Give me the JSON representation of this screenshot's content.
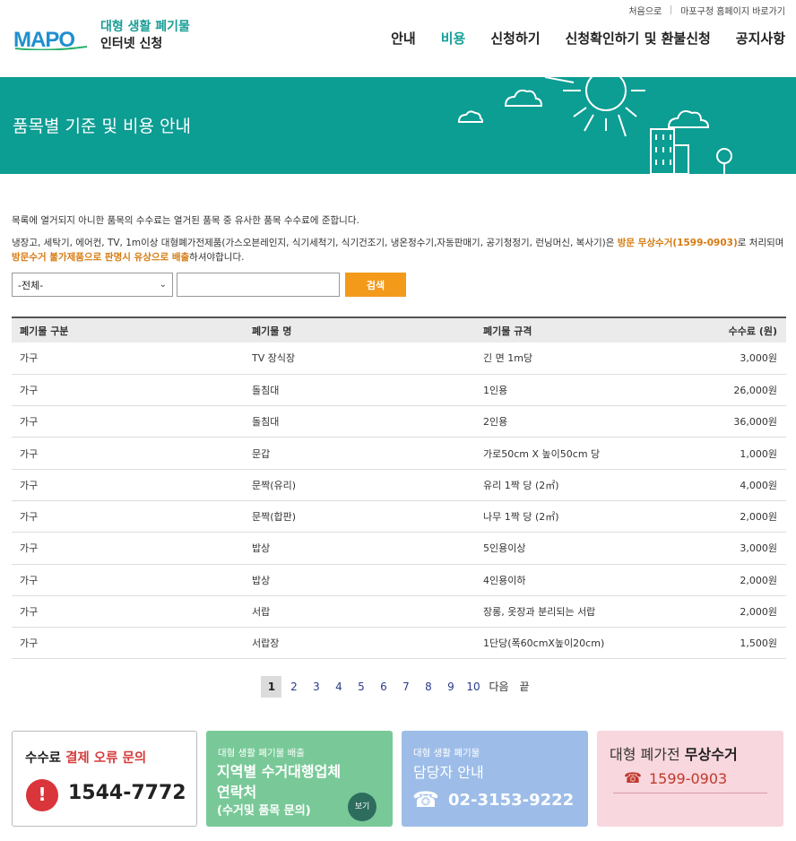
{
  "topbar": {
    "home": "처음으로",
    "mapo": "마포구청 홈페이지 바로가기"
  },
  "logo": {
    "mark": "MAPO",
    "line1": "대형 생활 폐기물",
    "line2": "인터넷 신청"
  },
  "gnb": [
    "안내",
    "비용",
    "신청하기",
    "신청확인하기 및 환불신청",
    "공지사항"
  ],
  "banner": {
    "title": "품목별 기준 및 비용 안내"
  },
  "notes": {
    "n1": "목록에 열거되지 아니한 품목의 수수료는 열거된 품목 중 유사한 품목 수수료에 준합니다.",
    "n2a": "냉장고, 세탁기, 에어컨, TV, 1m이상 대형폐가전제품(가스오븐레인지, 식기세척기, 식기건조기, 냉온정수기,자동판매기, 공기청정기, 런닝머신, 복사기)은 ",
    "n2b": "방문 무상수거(1599-0903)",
    "n2c": "로 처리되며 ",
    "n2d": "방문수거 불가제품으로 판명시 유상으로 배출",
    "n2e": "하셔야합니다."
  },
  "search": {
    "select_value": "-전체-",
    "input_value": "",
    "button": "검색"
  },
  "table": {
    "headers": [
      "폐기물 구분",
      "폐기물 명",
      "폐기물 규격",
      "수수료 (원)"
    ],
    "rows": [
      [
        "가구",
        "TV 장식장",
        "긴 면 1m당",
        "3,000원"
      ],
      [
        "가구",
        "돌침대",
        "1인용",
        "26,000원"
      ],
      [
        "가구",
        "돌침대",
        "2인용",
        "36,000원"
      ],
      [
        "가구",
        "문갑",
        "가로50cm X 높이50cm 당",
        "1,000원"
      ],
      [
        "가구",
        "문짝(유리)",
        "유리 1짝 당 (2㎡)",
        "4,000원"
      ],
      [
        "가구",
        "문짝(합판)",
        "나무 1짝 당 (2㎡)",
        "2,000원"
      ],
      [
        "가구",
        "밥상",
        "5인용이상",
        "3,000원"
      ],
      [
        "가구",
        "밥상",
        "4인용이하",
        "2,000원"
      ],
      [
        "가구",
        "서랍",
        "장롱, 옷장과 분리되는 서랍",
        "2,000원"
      ],
      [
        "가구",
        "서랍장",
        "1단당(폭60cmX높이20cm)",
        "1,500원"
      ]
    ]
  },
  "pager": {
    "pages": [
      "1",
      "2",
      "3",
      "4",
      "5",
      "6",
      "7",
      "8",
      "9",
      "10"
    ],
    "current": "1",
    "next": "다음",
    "last": "끝"
  },
  "boxes": {
    "b1": {
      "a": "수수료 ",
      "b": "결제 오류 문의",
      "warn": "!",
      "number": "1544-7772"
    },
    "b2": {
      "sub": "대형 생활 폐기물 배출",
      "title1": "지역별 수거대행업체",
      "title2": "연락처",
      "title3": "(수거및 품목 문의)",
      "view": "보기"
    },
    "b3": {
      "sub": "대형 생활 폐기물",
      "title": "담당자 안내",
      "phone_icon": "☎",
      "number": "02-3153-9222"
    },
    "b4": {
      "a": "대형 폐가전 ",
      "b": "무상수거",
      "phone_icon": "☎",
      "number": "1599-0903"
    }
  }
}
